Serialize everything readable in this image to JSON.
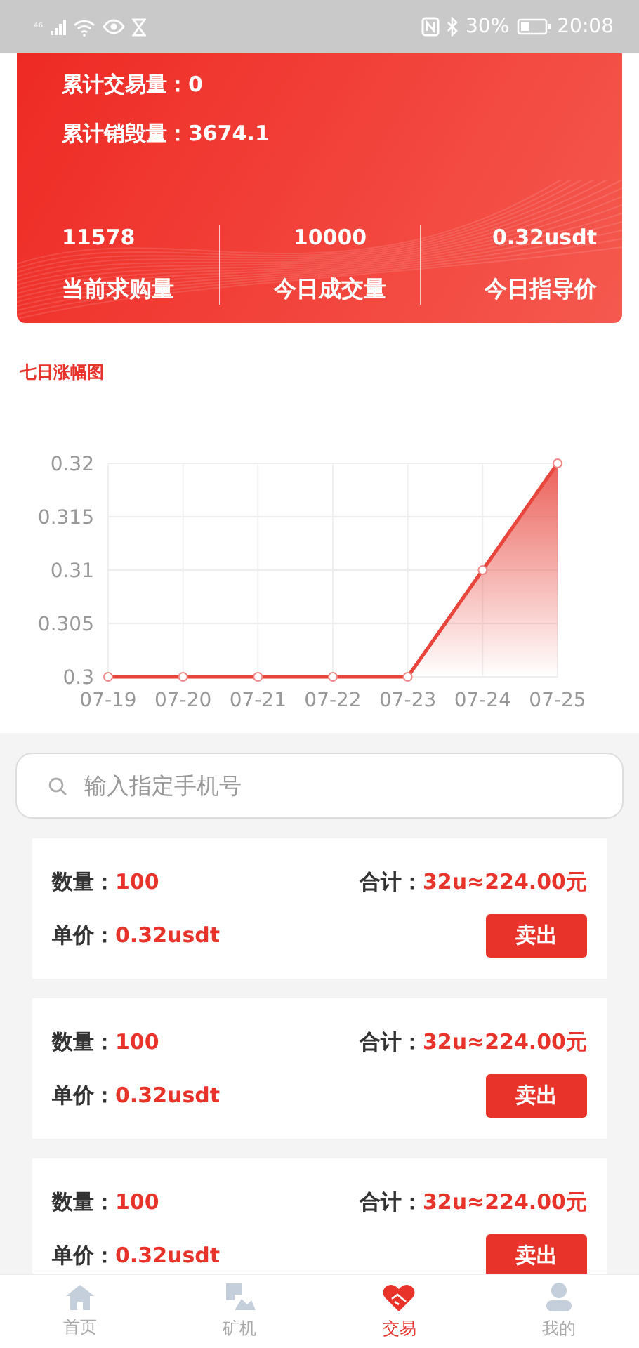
{
  "status_bar": {
    "left": "⁴⁶",
    "battery": "30%",
    "time": "20:08"
  },
  "summary": {
    "lines": [
      {
        "label": "累计交易量：",
        "value": "0"
      },
      {
        "label": "累计销毁量：",
        "value": "3674.1"
      }
    ],
    "stats": [
      {
        "value": "11578",
        "label": "当前求购量"
      },
      {
        "value": "10000",
        "label": "今日成交量"
      },
      {
        "value": "0.32usdt",
        "label": "今日指导价"
      }
    ]
  },
  "chart_title": "七日涨幅图",
  "chart": {
    "chart_data": {
      "type": "area",
      "categories": [
        "07-19",
        "07-20",
        "07-21",
        "07-22",
        "07-23",
        "07-24",
        "07-25"
      ],
      "grid": true,
      "series": [
        {
          "color": "#e8453c",
          "values": [
            0.3,
            0.3,
            0.3,
            0.3,
            0.3,
            0.31,
            0.32
          ]
        }
      ],
      "ylim": [
        0.3,
        0.32
      ],
      "yticks": [
        0.3,
        0.305,
        0.31,
        0.315,
        0.32
      ]
    }
  },
  "search": {
    "placeholder": "输入指定手机号"
  },
  "orders": [
    {
      "qty_label": "数量：",
      "qty": "100",
      "total_label": "合计：",
      "total": "32u≈224.00元",
      "price_label": "单价：",
      "price": "0.32usdt",
      "button": "卖出"
    },
    {
      "qty_label": "数量：",
      "qty": "100",
      "total_label": "合计：",
      "total": "32u≈224.00元",
      "price_label": "单价：",
      "price": "0.32usdt",
      "button": "卖出"
    },
    {
      "qty_label": "数量：",
      "qty": "100",
      "total_label": "合计：",
      "total": "32u≈224.00元",
      "price_label": "单价：",
      "price": "0.32usdt",
      "button": "卖出"
    }
  ],
  "tabs": [
    {
      "label": "首页",
      "selected": false
    },
    {
      "label": "矿机",
      "selected": false
    },
    {
      "label": "交易",
      "selected": true
    },
    {
      "label": "我的",
      "selected": false
    }
  ]
}
